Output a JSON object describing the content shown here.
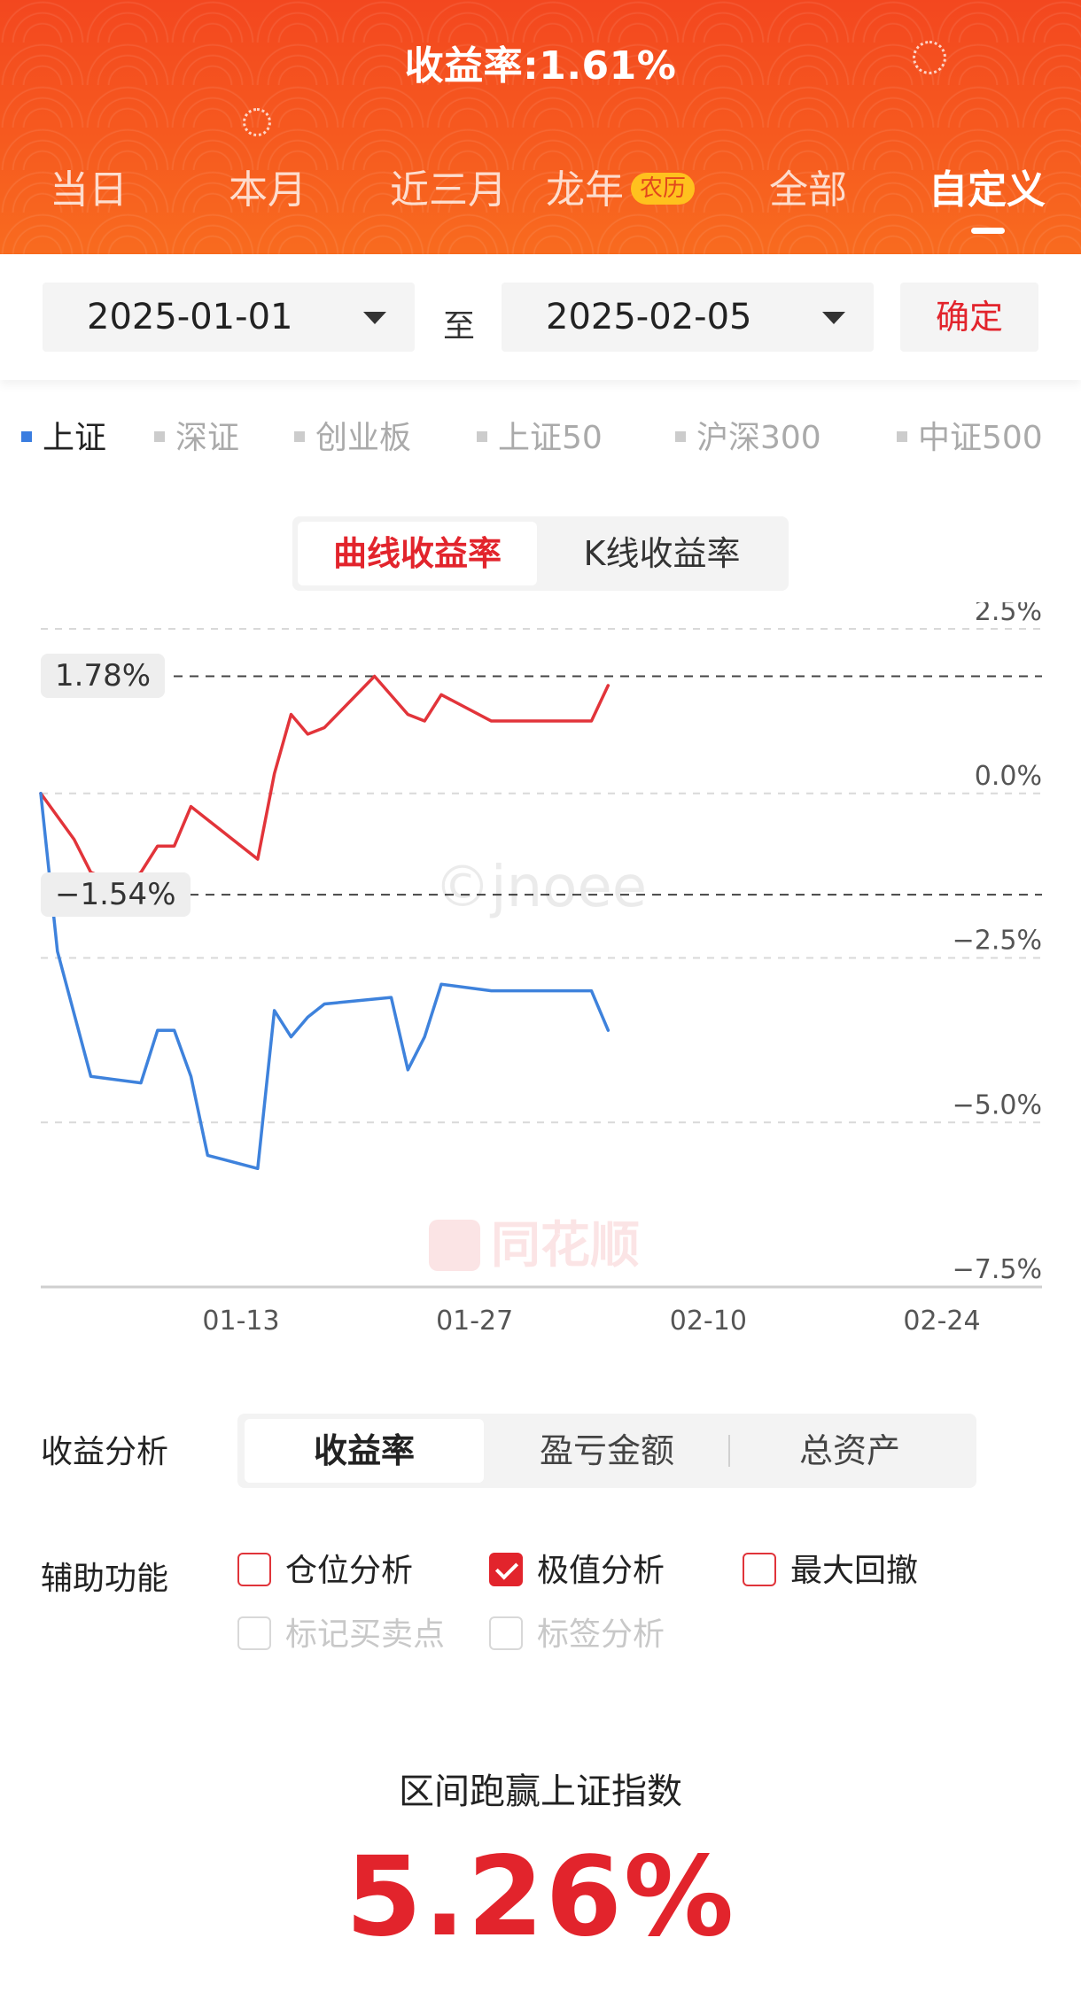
{
  "header": {
    "title": "收益率:1.61%",
    "tabs": [
      {
        "label": "当日"
      },
      {
        "label": "本月"
      },
      {
        "label": "近三月"
      },
      {
        "label": "龙年",
        "badge": "农历"
      },
      {
        "label": "全部"
      },
      {
        "label": "自定义"
      }
    ],
    "active_tab": "自定义"
  },
  "date_range": {
    "start": "2025-01-01",
    "separator": "至",
    "end": "2025-02-05",
    "confirm_label": "确定"
  },
  "index_tabs": [
    "上证",
    "深证",
    "创业板",
    "上证50",
    "沪深300",
    "中证500"
  ],
  "active_index": "上证",
  "chart_mode": {
    "options": [
      "曲线收益率",
      "K线收益率"
    ],
    "active": "曲线收益率"
  },
  "chart_labels": {
    "max": "1.78%",
    "min": "−1.54%"
  },
  "watermarks": {
    "text": "©jnoee",
    "logo": "同花顺"
  },
  "chart_data": {
    "type": "line",
    "y_ticks": [
      "2.5%",
      "0.0%",
      "−2.5%",
      "−5.0%",
      "−7.5%"
    ],
    "ylim": [
      -7.5,
      2.5
    ],
    "x_ticks": [
      "01-13",
      "01-27",
      "02-10",
      "02-24"
    ],
    "x_tick_days": [
      12,
      26,
      40,
      54
    ],
    "xlim": [
      0,
      60
    ],
    "grid": true,
    "reference_lines": [
      1.78,
      -1.54
    ],
    "colors": {
      "portfolio": "#e2343a",
      "index": "#3e82dc"
    },
    "series": [
      {
        "key": "portfolio",
        "x": [
          0,
          2,
          3,
          5,
          6,
          7,
          8,
          9,
          10,
          13,
          14,
          15,
          16,
          17,
          20,
          22,
          23,
          24,
          27,
          33,
          34
        ],
        "values": [
          0,
          -0.7,
          -1.2,
          -1.4,
          -1.2,
          -0.8,
          -0.8,
          -0.2,
          -0.4,
          -1.0,
          0.3,
          1.2,
          0.9,
          1.0,
          1.78,
          1.2,
          1.1,
          1.5,
          1.1,
          1.1,
          1.64
        ]
      },
      {
        "key": "index",
        "x": [
          0,
          1,
          3,
          6,
          7,
          8,
          9,
          10,
          13,
          14,
          15,
          16,
          17,
          21,
          22,
          23,
          24,
          27,
          33,
          34
        ],
        "values": [
          0,
          -2.4,
          -4.3,
          -4.4,
          -3.6,
          -3.6,
          -4.3,
          -5.5,
          -5.7,
          -3.3,
          -3.7,
          -3.4,
          -3.2,
          -3.1,
          -4.2,
          -3.7,
          -2.9,
          -3.0,
          -3.0,
          -3.6
        ]
      }
    ]
  },
  "analysis": {
    "label": "收益分析",
    "options": [
      "收益率",
      "盈亏金额",
      "总资产"
    ],
    "active": "收益率"
  },
  "aux": {
    "label": "辅助功能",
    "items": [
      {
        "label": "仓位分析",
        "checked": false,
        "enabled": true
      },
      {
        "label": "极值分析",
        "checked": true,
        "enabled": true
      },
      {
        "label": "最大回撤",
        "checked": false,
        "enabled": true
      },
      {
        "label": "标记买卖点",
        "checked": false,
        "enabled": false
      },
      {
        "label": "标签分析",
        "checked": false,
        "enabled": false
      }
    ]
  },
  "outperformance": {
    "title": "区间跑赢上证指数",
    "value": "5.26%"
  }
}
